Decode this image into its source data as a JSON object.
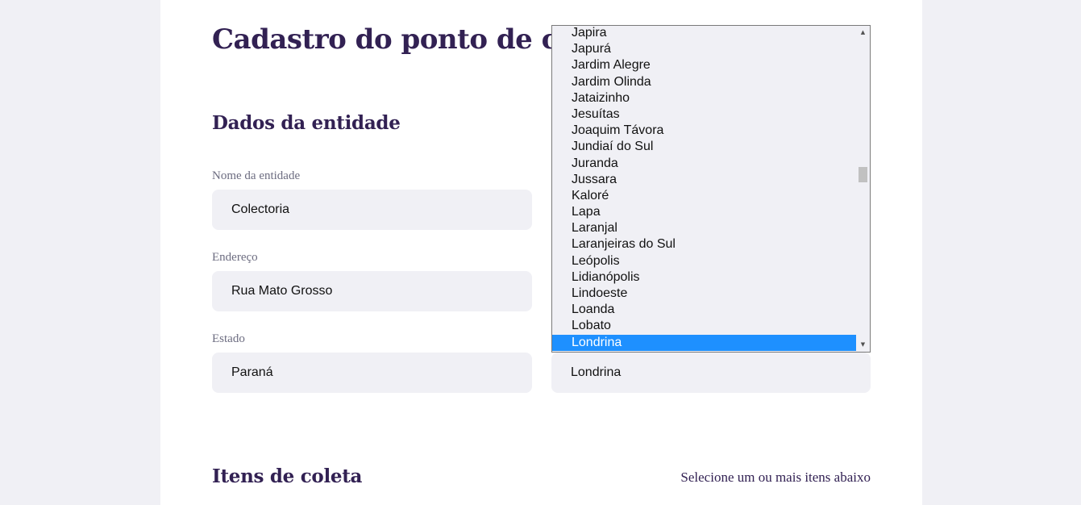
{
  "page": {
    "title": "Cadastro do ponto de coleta"
  },
  "entity_section": {
    "title": "Dados da entidade",
    "name_label": "Nome da entidade",
    "name_value": "Colectoria",
    "address_label": "Endereço",
    "address_value": "Rua Mato Grosso",
    "state_label": "Estado",
    "state_value": "Paraná",
    "city_value": "Londrina"
  },
  "city_dropdown": {
    "options": [
      "Japira",
      "Japurá",
      "Jardim Alegre",
      "Jardim Olinda",
      "Jataizinho",
      "Jesuítas",
      "Joaquim Távora",
      "Jundiaí do Sul",
      "Juranda",
      "Jussara",
      "Kaloré",
      "Lapa",
      "Laranjal",
      "Laranjeiras do Sul",
      "Leópolis",
      "Lidianópolis",
      "Lindoeste",
      "Loanda",
      "Lobato",
      "Londrina"
    ],
    "selected": "Londrina",
    "scroll_up_icon": "triangle-up-icon",
    "scroll_down_icon": "triangle-down-icon"
  },
  "items_section": {
    "title": "Itens de coleta",
    "hint": "Selecione um ou mais itens abaixo"
  },
  "colors": {
    "title": "#322153",
    "field_bg": "#f0f0f5",
    "selected_option": "#1e90ff"
  }
}
